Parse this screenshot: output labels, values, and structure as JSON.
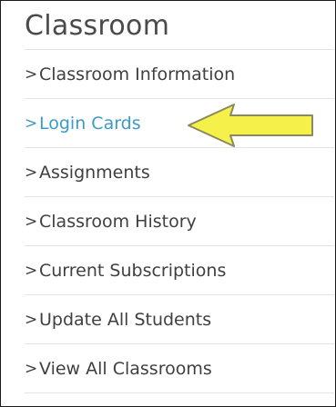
{
  "sidebar": {
    "title": "Classroom",
    "items": [
      {
        "chevron": ">",
        "label": "Classroom Information",
        "active": false
      },
      {
        "chevron": ">",
        "label": "Login Cards",
        "active": true
      },
      {
        "chevron": ">",
        "label": "Assignments",
        "active": false
      },
      {
        "chevron": ">",
        "label": "Classroom History",
        "active": false
      },
      {
        "chevron": ">",
        "label": "Current Subscriptions",
        "active": false
      },
      {
        "chevron": ">",
        "label": "Update All Students",
        "active": false
      },
      {
        "chevron": ">",
        "label": "View All Classrooms",
        "active": false
      }
    ]
  },
  "annotation": {
    "icon": "yellow-left-arrow-icon",
    "fill": "#f5f14a",
    "stroke": "#8a8a5c"
  },
  "colors": {
    "active_link": "#3b9ac9",
    "text": "#3f3f3f",
    "title": "#4a4a4a",
    "divider": "#e4e4e4",
    "border": "#1a1a1a"
  }
}
